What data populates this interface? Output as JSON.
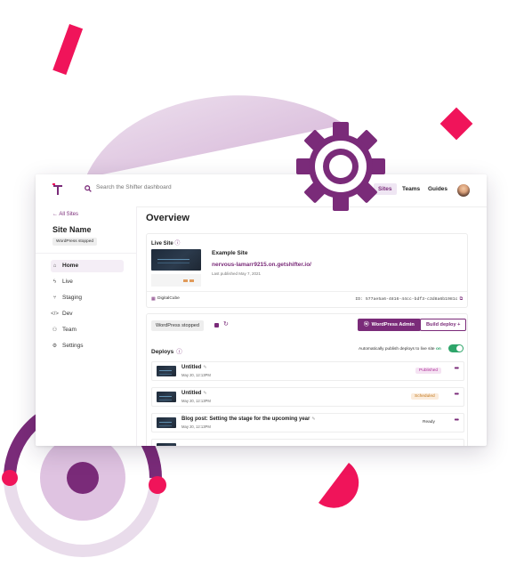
{
  "colors": {
    "brand": "#7a2b79",
    "accent": "#f0145a",
    "success": "#2ea56a",
    "background": "#ffffff"
  },
  "topbar": {
    "logo_icon": "shifter-logo-icon",
    "search_icon": "search-icon",
    "search_placeholder": "Search the Shifter dashboard",
    "nav": {
      "sites": "Sites",
      "teams": "Teams",
      "guides": "Guides"
    },
    "active_nav": "Sites",
    "avatar_icon": "user-avatar"
  },
  "sidebar": {
    "back_label": "← All Sites",
    "site_name": "Site Name",
    "status_badge": "WordPress stopped",
    "items": [
      {
        "label": "Home",
        "icon": "home-icon",
        "glyph": "⌂",
        "active": true
      },
      {
        "label": "Live",
        "icon": "lightning-icon",
        "glyph": "ϟ",
        "active": false
      },
      {
        "label": "Staging",
        "icon": "branch-icon",
        "glyph": "⑂",
        "active": false
      },
      {
        "label": "Dev",
        "icon": "code-icon",
        "glyph": "</>",
        "active": false
      },
      {
        "label": "Team",
        "icon": "users-icon",
        "glyph": "⚇",
        "active": false
      },
      {
        "label": "Settings",
        "icon": "gear-icon",
        "glyph": "⚙",
        "active": false
      }
    ]
  },
  "main": {
    "title": "Overview",
    "live_site": {
      "heading": "Live Site",
      "info_glyph": "ⓘ",
      "site_title": "Example Site",
      "url": "nervous-lamarr9215.on.getshifter.io/",
      "published": "Last published May 7, 2021",
      "team": "DigitalCube",
      "site_id": "ID: 577ae5a6-4816-44cc-bdf3-c3d8a6b1981c",
      "copy_glyph": "⧉"
    },
    "controls": {
      "status": "WordPress stopped",
      "stop_icon": "stop-icon",
      "refresh_glyph": "↻",
      "wp_admin_glyph": "ⓦ",
      "wp_admin": "WordPress Admin",
      "build_deploy": "Build deploy +"
    },
    "deploys": {
      "heading": "Deploys",
      "info_glyph": "ⓘ",
      "auto_publish_text": "Automatically publish deploys to live site",
      "auto_publish_state": "on",
      "toggle_on": true,
      "items": [
        {
          "title": "Untitled",
          "date": "May 20, 12:13PM",
          "status": "Published",
          "edit_glyph": "✎"
        },
        {
          "title": "Untitled",
          "date": "May 20, 12:13PM",
          "status": "Scheduled",
          "edit_glyph": "✎"
        },
        {
          "title": "Blog post: Setting the stage for the upcoming year",
          "date": "May 20, 12:13PM",
          "status": "Ready",
          "edit_glyph": "✎"
        }
      ],
      "more_glyph": "•••"
    }
  }
}
